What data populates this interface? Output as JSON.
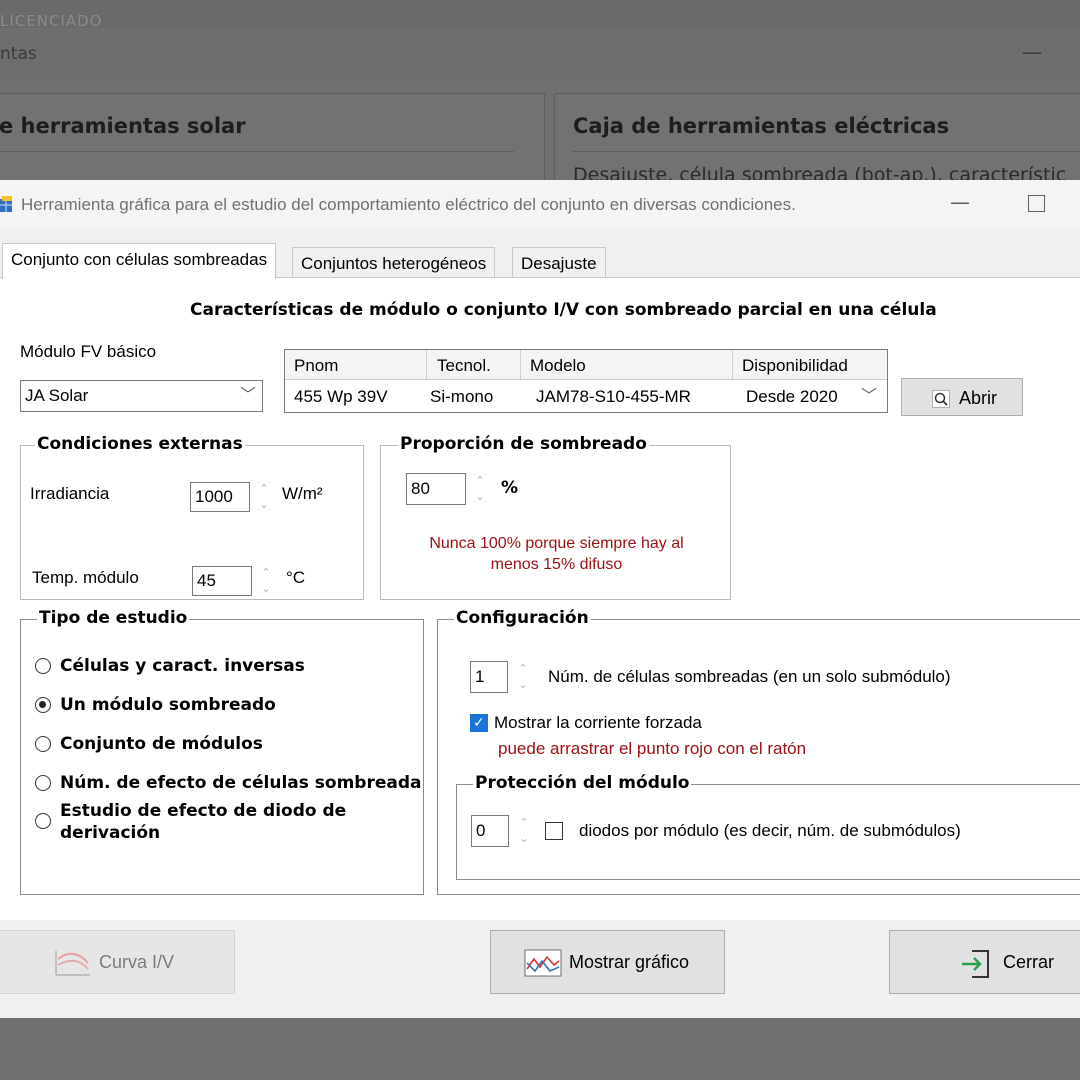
{
  "background": {
    "top_text": "LICENCIADO",
    "window_title": "ntas",
    "panel_left_title": "e herramientas solar",
    "panel_right_title": "Caja de herramientas eléctricas",
    "panel_right_sub": "Desajuste, célula sombreada (bot-ap.), característic"
  },
  "dialog": {
    "title": "Herramienta gráfica para el estudio del comportamiento eléctrico del conjunto en diversas condiciones.",
    "tabs": [
      "Conjunto con células sombreadas",
      "Conjuntos heterogéneos",
      "Desajuste"
    ],
    "heading": "Características de módulo o conjunto I/V con sombreado parcial en una célula",
    "module_label": "Módulo FV básico",
    "module_brand": "JA Solar",
    "module_table": {
      "headers": [
        "Pnom",
        "Tecnol.",
        "Modelo",
        "Disponibilidad"
      ],
      "row": [
        "455 Wp 39V",
        "Si-mono",
        "JAM78-S10-455-MR",
        "Desde 2020"
      ]
    },
    "open_button": "Abrir",
    "ext_conditions": {
      "title": "Condiciones externas",
      "irradiance_label": "Irradiancia",
      "irradiance_value": "1000",
      "irradiance_unit": "W/m²",
      "temp_label": "Temp. módulo",
      "temp_value": "45",
      "temp_unit": "°C"
    },
    "shading": {
      "title": "Proporción de sombreado",
      "value": "80",
      "unit": "%",
      "note_line1": "Nunca 100% porque siempre hay al",
      "note_line2": "menos 15% difuso"
    },
    "study_type": {
      "title": "Tipo de estudio",
      "options": [
        "Células y caract. inversas",
        "Un módulo sombreado",
        "Conjunto de módulos",
        "Núm. de efecto de células sombreada",
        "Estudio de efecto de diodo de",
        "derivación"
      ],
      "selected": "Un módulo sombreado"
    },
    "configuration": {
      "title": "Configuración",
      "cells_value": "1",
      "cells_label": "Núm. de células sombreadas (en un solo submódulo)",
      "show_current_label": "Mostrar la corriente forzada",
      "show_current_checked": true,
      "drag_note": "puede arrastrar el punto rojo con el ratón",
      "protection": {
        "title": "Protección del módulo",
        "diodes_value": "0",
        "diodes_label": "diodos por módulo (es decir, núm. de submódulos)",
        "checked": false
      }
    },
    "buttons": {
      "curve": "Curva I/V",
      "show_graph": "Mostrar gráfico",
      "close": "Cerrar"
    }
  }
}
